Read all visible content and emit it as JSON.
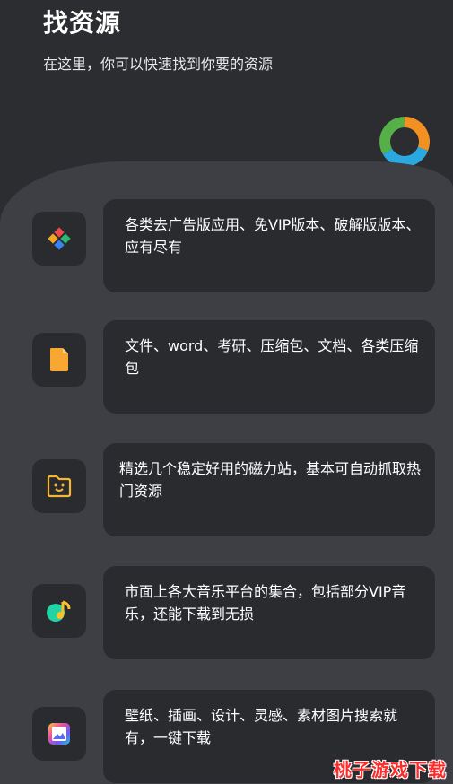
{
  "header": {
    "title": "找资源",
    "subtitle": "在这里，你可以快速找到你要的资源",
    "logo_icon": "cycle-logo-icon"
  },
  "items": [
    {
      "icon": "app-grid-icon",
      "text": "各类去广告版应用、免VIP版本、破解版版本、应有尽有"
    },
    {
      "icon": "document-icon",
      "text": "文件、word、考研、压缩包、文档、各类压缩包"
    },
    {
      "icon": "magnet-folder-icon",
      "text": "精选几个稳定好用的磁力站，基本可自动抓取热门资源"
    },
    {
      "icon": "music-note-icon",
      "text": "市面上各大音乐平台的集合，包括部分VIP音乐，还能下载到无损"
    },
    {
      "icon": "wallpaper-image-icon",
      "text": "壁纸、插画、设计、灵感、素材图片搜索就有，一键下载"
    }
  ],
  "watermark": "桃子游戏下载",
  "colors": {
    "background": "#2b2d31",
    "panel": "#3d3f44",
    "card": "#2a2b2f",
    "watermark": "#ff2a2a"
  }
}
